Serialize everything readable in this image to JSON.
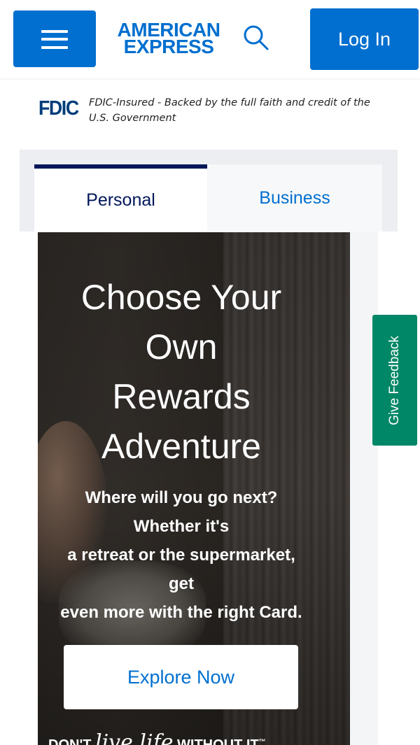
{
  "header": {
    "logo_line1": "AMERICAN",
    "logo_line2": "EXPRESS",
    "login_label": "Log In",
    "icons": {
      "menu": "hamburger-menu-icon",
      "search": "search-icon"
    }
  },
  "fdic": {
    "logo": "FDIC",
    "text": "FDIC-Insured - Backed by the full faith and credit of the U.S. Government"
  },
  "tabs": [
    {
      "label": "Personal",
      "active": true
    },
    {
      "label": "Business",
      "active": false
    }
  ],
  "hero": {
    "title_lines": [
      "Choose Your",
      "Own",
      "Rewards",
      "Adventure"
    ],
    "subtitle_lines": [
      "Where will you go next?",
      "Whether it's",
      "a retreat or the supermarket,",
      "get",
      "even more with the right Card."
    ],
    "cta_label": "Explore Now",
    "tagline_left": "DON'T",
    "tagline_script": "live life",
    "tagline_right": "WITHOUT IT",
    "tagline_mark": "™"
  },
  "feedback": {
    "label": "Give Feedback"
  },
  "colors": {
    "brand_blue": "#006fcf",
    "navy": "#00175a",
    "feedback_green": "#008767",
    "tabs_background": "#eceef1"
  }
}
